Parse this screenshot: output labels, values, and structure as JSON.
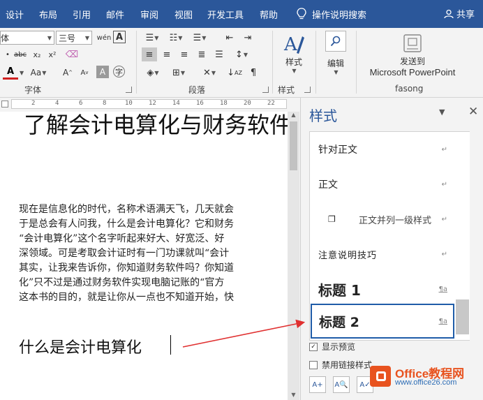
{
  "tabs": [
    "设计",
    "布局",
    "引用",
    "邮件",
    "审阅",
    "视图",
    "开发工具",
    "帮助"
  ],
  "tell_me": "操作说明搜索",
  "share": "共享",
  "ribbon": {
    "font": {
      "name_value": "宋体",
      "size_value": "三号",
      "group_label": "字体"
    },
    "paragraph": {
      "group_label": "段落"
    },
    "styles_group": {
      "button_label": "样式",
      "group_label": "样式"
    },
    "editing": {
      "button_label": "编辑"
    },
    "fasong": {
      "send_label_1": "发送到",
      "send_label_2": "Microsoft PowerPoint",
      "group_label": "fasong"
    }
  },
  "ruler": [
    "2",
    "4",
    "6",
    "8",
    "10",
    "12",
    "14",
    "16",
    "18",
    "20",
    "22"
  ],
  "document": {
    "heading": "了解会计电算化与财务软件",
    "paragraph": [
      "现在是信息化的时代，名称术语满天飞，几天就会",
      "于是总会有人问我，什么是会计电算化？它和财务",
      "“会计电算化”这个名字听起来好大、好宽泛、好",
      "深领域。可是考取会计证时有一门功课就叫“会计",
      "其实，让我来告诉你，你知道财务软件吗？你知道",
      "化”只不过是通过财务软件实现电脑记账的“官方",
      "这本书的目的，就是让你从一点也不知道开始，快"
    ],
    "subheading": "什么是会计电算化"
  },
  "styles_pane": {
    "title": "样式",
    "items": [
      {
        "name": "针对正文",
        "mark": "↵"
      },
      {
        "name": "正文",
        "mark": "↵"
      },
      {
        "name": "正文并列一级样式",
        "mark": "↵"
      },
      {
        "name": "注意说明技巧",
        "mark": "↵"
      },
      {
        "name": "标题 1",
        "mark": "¶a"
      },
      {
        "name": "标题 2",
        "mark": "¶a"
      }
    ],
    "selected_index": 5,
    "show_preview": {
      "label": "显示预览",
      "checked": true
    },
    "disable_linked": {
      "label": "禁用链接样式",
      "checked": false
    }
  },
  "watermark": {
    "title": "Office教程网",
    "url": "www.office26.com"
  },
  "colors": {
    "tabbar": "#2b579a",
    "selected_border": "#1f5ca8",
    "arrow": "#e03030"
  }
}
